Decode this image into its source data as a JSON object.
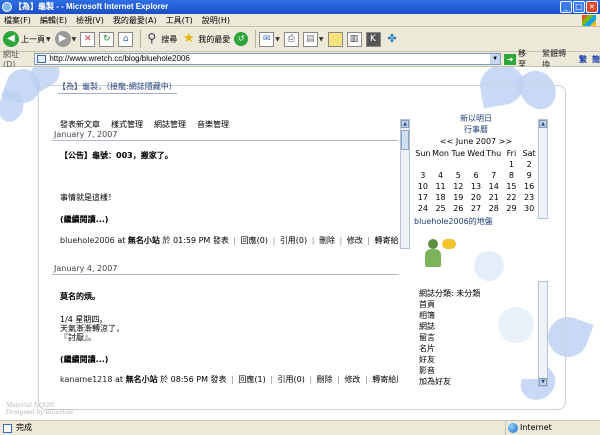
{
  "window": {
    "title": "【為】龜製 - - Microsoft Internet Explorer",
    "buttons": [
      "_",
      "□",
      "×"
    ]
  },
  "menu": [
    "檔案(F)",
    "編輯(E)",
    "檢視(V)",
    "我的最愛(A)",
    "工具(T)",
    "說明(H)"
  ],
  "toolbar": {
    "back": "上一頁",
    "search": "搜尋",
    "favorites": "我的最愛"
  },
  "address": {
    "label": "網址(D)",
    "url": "http://www.wretch.cc/blog/bluehole2006",
    "go": "移至",
    "extra1": "繁體轉換",
    "extra2": "繁",
    "extra3": "簡"
  },
  "blog": {
    "title": "【為】龜製，（接龍:網誌隱藏中）",
    "nav": [
      "發表新文章",
      "樣式管理",
      "網誌管理",
      "音樂管理"
    ]
  },
  "posts": [
    {
      "date": "January 7, 2007",
      "title": "【公告】龜號：003，搬家了。",
      "lines": [
        "事情就是這樣！"
      ],
      "read_more": "(繼續閱讀...)",
      "author": "bluehole2006",
      "at": "at",
      "place": "無名小站",
      "when": "於 01:59 PM 發表",
      "reply": "回應(0)",
      "quote": "引用(0)",
      "delete": "刪除",
      "edit": "修改",
      "forward": "轉寄給朋友"
    },
    {
      "date": "January 4, 2007",
      "title": "莫名的煩。",
      "lines": [
        "1/4 星期四。",
        "天氣漸漸轉涼了，",
        "『討厭』。"
      ],
      "read_more": "(繼續閱讀...)",
      "author": "kaname1218",
      "at": "at",
      "place": "無名小站",
      "when": "於 08:56 PM 發表",
      "reply": "回應(1)",
      "quote": "引用(0)",
      "delete": "刪除",
      "edit": "修改",
      "forward": "轉寄給朋友"
    }
  ],
  "sidebar": {
    "heading1": "新以明日",
    "heading2": "行事曆",
    "cal_nav": "<< June 2007 >>",
    "weekdays": [
      "Sun",
      "Mon",
      "Tue",
      "Wed",
      "Thu",
      "Fri",
      "Sat"
    ],
    "days": [
      "",
      "",
      "",
      "",
      "",
      "1",
      "2",
      "3",
      "4",
      "5",
      "6",
      "7",
      "8",
      "9",
      "10",
      "11",
      "12",
      "13",
      "14",
      "15",
      "16",
      "17",
      "18",
      "19",
      "20",
      "21",
      "22",
      "23",
      "24",
      "25",
      "26",
      "27",
      "28",
      "29",
      "30"
    ],
    "map_link": "bluehole2006的地盤",
    "category": "網誌分類: 未分類",
    "menu": [
      "首頁",
      "相簿",
      "網誌",
      "留言",
      "名片",
      "好友",
      "影音",
      "加為好友"
    ]
  },
  "watermark": [
    "Material NOON",
    "Designed by BlueHole"
  ],
  "status": {
    "text": "完成",
    "zone": "Internet"
  }
}
